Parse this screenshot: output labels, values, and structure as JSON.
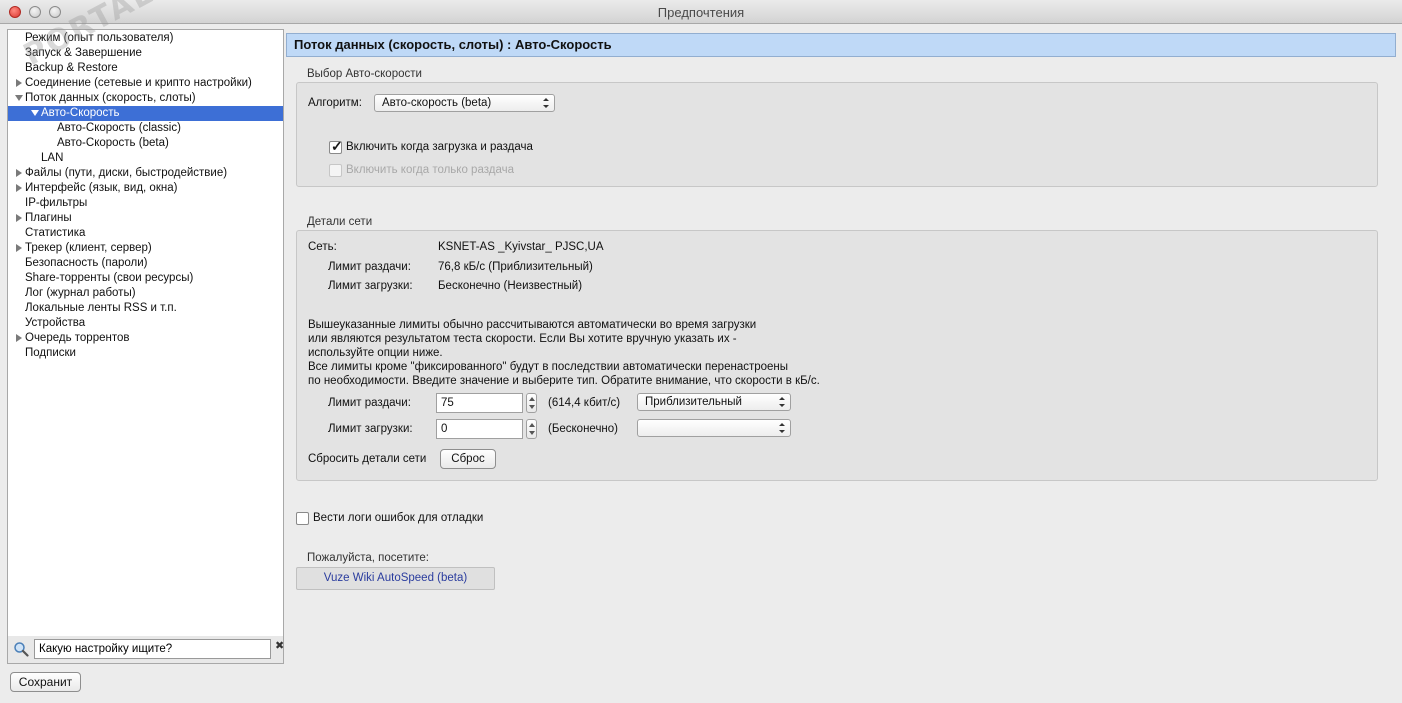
{
  "window": {
    "title": "Предпочтения"
  },
  "sidebar": {
    "watermark": "PORTAL",
    "items": [
      {
        "label": "Режим (опыт пользователя)"
      },
      {
        "label": "Запуск & Завершение"
      },
      {
        "label": "Backup & Restore"
      },
      {
        "label": "Соединение (сетевые и крипто настройки)"
      },
      {
        "label": "Поток данных (скорость, слоты)"
      },
      {
        "label": "Авто-Скорость"
      },
      {
        "label": "Авто-Скорость (classic)"
      },
      {
        "label": "Авто-Скорость (beta)"
      },
      {
        "label": "LAN"
      },
      {
        "label": "Файлы (пути, диски, быстродействие)"
      },
      {
        "label": "Интерфейс (язык, вид, окна)"
      },
      {
        "label": "IP-фильтры"
      },
      {
        "label": "Плагины"
      },
      {
        "label": "Статистика"
      },
      {
        "label": "Трекер (клиент, сервер)"
      },
      {
        "label": "Безопасность (пароли)"
      },
      {
        "label": "Share-торренты (свои ресурсы)"
      },
      {
        "label": "Лог (журнал работы)"
      },
      {
        "label": "Локальные ленты RSS и т.п."
      },
      {
        "label": "Устройства"
      },
      {
        "label": "Очередь торрентов"
      },
      {
        "label": "Подписки"
      }
    ],
    "search_value": "Какую настройку ищите?",
    "clear_glyph": "✖"
  },
  "footer": {
    "save_label": "Сохранит"
  },
  "main": {
    "header": "Поток данных (скорость, слоты) : Авто-Скорость",
    "autospeed": {
      "group_label": "Выбор Авто-скорости",
      "algorithm_label": "Алгоритм:",
      "algorithm_value": "Авто-скорость (beta)",
      "enable_both_label": "Включить когда загрузка и раздача",
      "enable_both_checked": true,
      "enable_seeding_label": "Включить когда только раздача",
      "enable_seeding_checked": false
    },
    "network": {
      "group_label": "Детали сети",
      "net_label": "Сеть:",
      "net_value": "KSNET-AS _Kyivstar_ PJSC,UA",
      "upload_limit_label": "Лимит раздачи:",
      "upload_limit_value": "76,8 кБ/с (Приблизительный)",
      "download_limit_label": "Лимит загрузки:",
      "download_limit_value": "Бесконечно (Неизвестный)",
      "info_lines": [
        "Вышеуказанные лимиты обычно рассчитываются автоматически во время загрузки",
        "или являются результатом теста скорости. Если Вы хотите вручную указать их -",
        "используйте опции ниже.",
        "Все лимиты кроме \"фиксированного\"  будут в последствии автоматически перенастроены",
        "по необходимости. Введите значение и выберите тип. Обратите внимание, что скорости в кБ/с."
      ],
      "upload_input_label": "Лимит раздачи:",
      "upload_input_value": "75",
      "upload_kbit": "(614,4 кбит/с)",
      "upload_type": "Приблизительный",
      "download_input_label": "Лимит загрузки:",
      "download_input_value": "0",
      "download_kbit": "(Бесконечно)",
      "download_type": "",
      "reset_label": "Сбросить детали сети",
      "reset_button": "Сброс"
    },
    "debug_log_label": "Вести логи  ошибок для отладки",
    "debug_log_checked": false,
    "visit_label": "Пожалуйста, посетите:",
    "wiki_link": "Vuze Wiki AutoSpeed (beta)"
  }
}
